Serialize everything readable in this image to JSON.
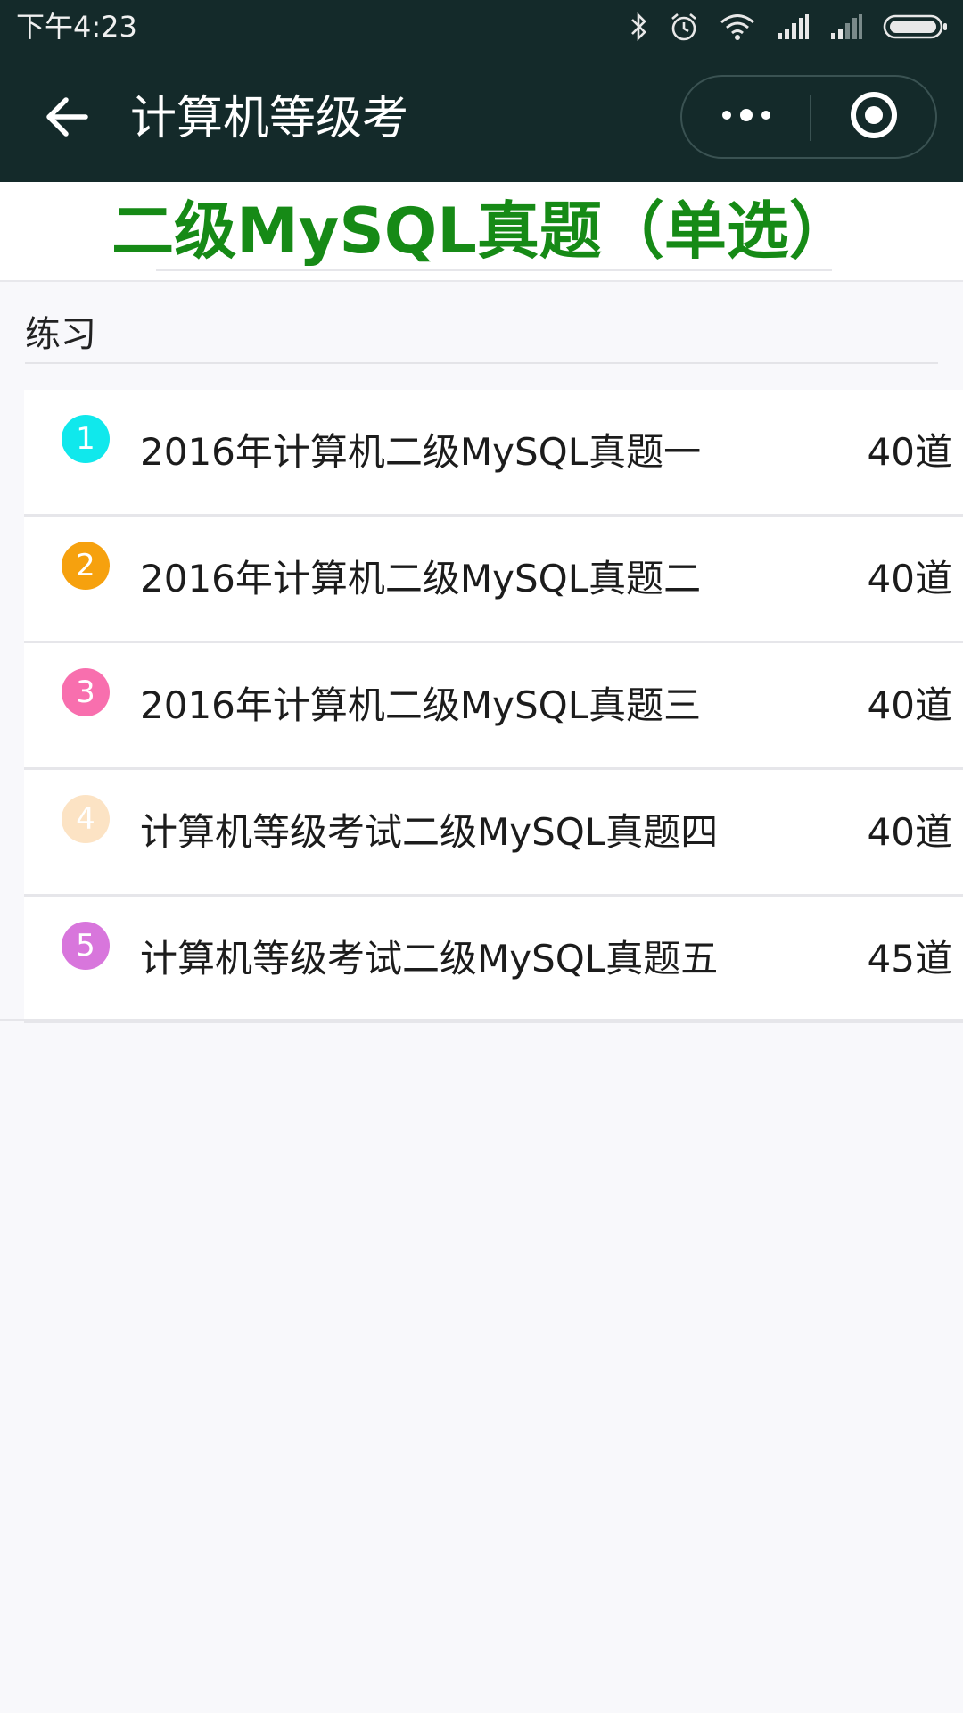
{
  "status_bar": {
    "time": "下午4:23"
  },
  "nav": {
    "title": "计算机等级考"
  },
  "header": {
    "title": "二级MySQL真题（单选）"
  },
  "section": {
    "label": "练习"
  },
  "items": [
    {
      "index": "1",
      "title": "2016年计算机二级MySQL真题一",
      "count": "40道",
      "color": "#10e8ec"
    },
    {
      "index": "2",
      "title": "2016年计算机二级MySQL真题二",
      "count": "40道",
      "color": "#f6a10e"
    },
    {
      "index": "3",
      "title": "2016年计算机二级MySQL真题三",
      "count": "40道",
      "color": "#f86fae"
    },
    {
      "index": "4",
      "title": "计算机等级考试二级MySQL真题四",
      "count": "40道",
      "color": "#fce3c4"
    },
    {
      "index": "5",
      "title": "计算机等级考试二级MySQL真题五",
      "count": "45道",
      "color": "#d876dc"
    }
  ],
  "colors": {
    "nav_background": "#142a2a",
    "title_green": "#168a16",
    "page_background": "#f8f8fb"
  },
  "icons": {
    "status": [
      "bluetooth-icon",
      "alarm-icon",
      "wifi-icon",
      "signal-icon",
      "signal-icon",
      "battery-icon"
    ],
    "nav": [
      "back-arrow-icon",
      "more-icon",
      "close-mini-program-icon"
    ]
  }
}
